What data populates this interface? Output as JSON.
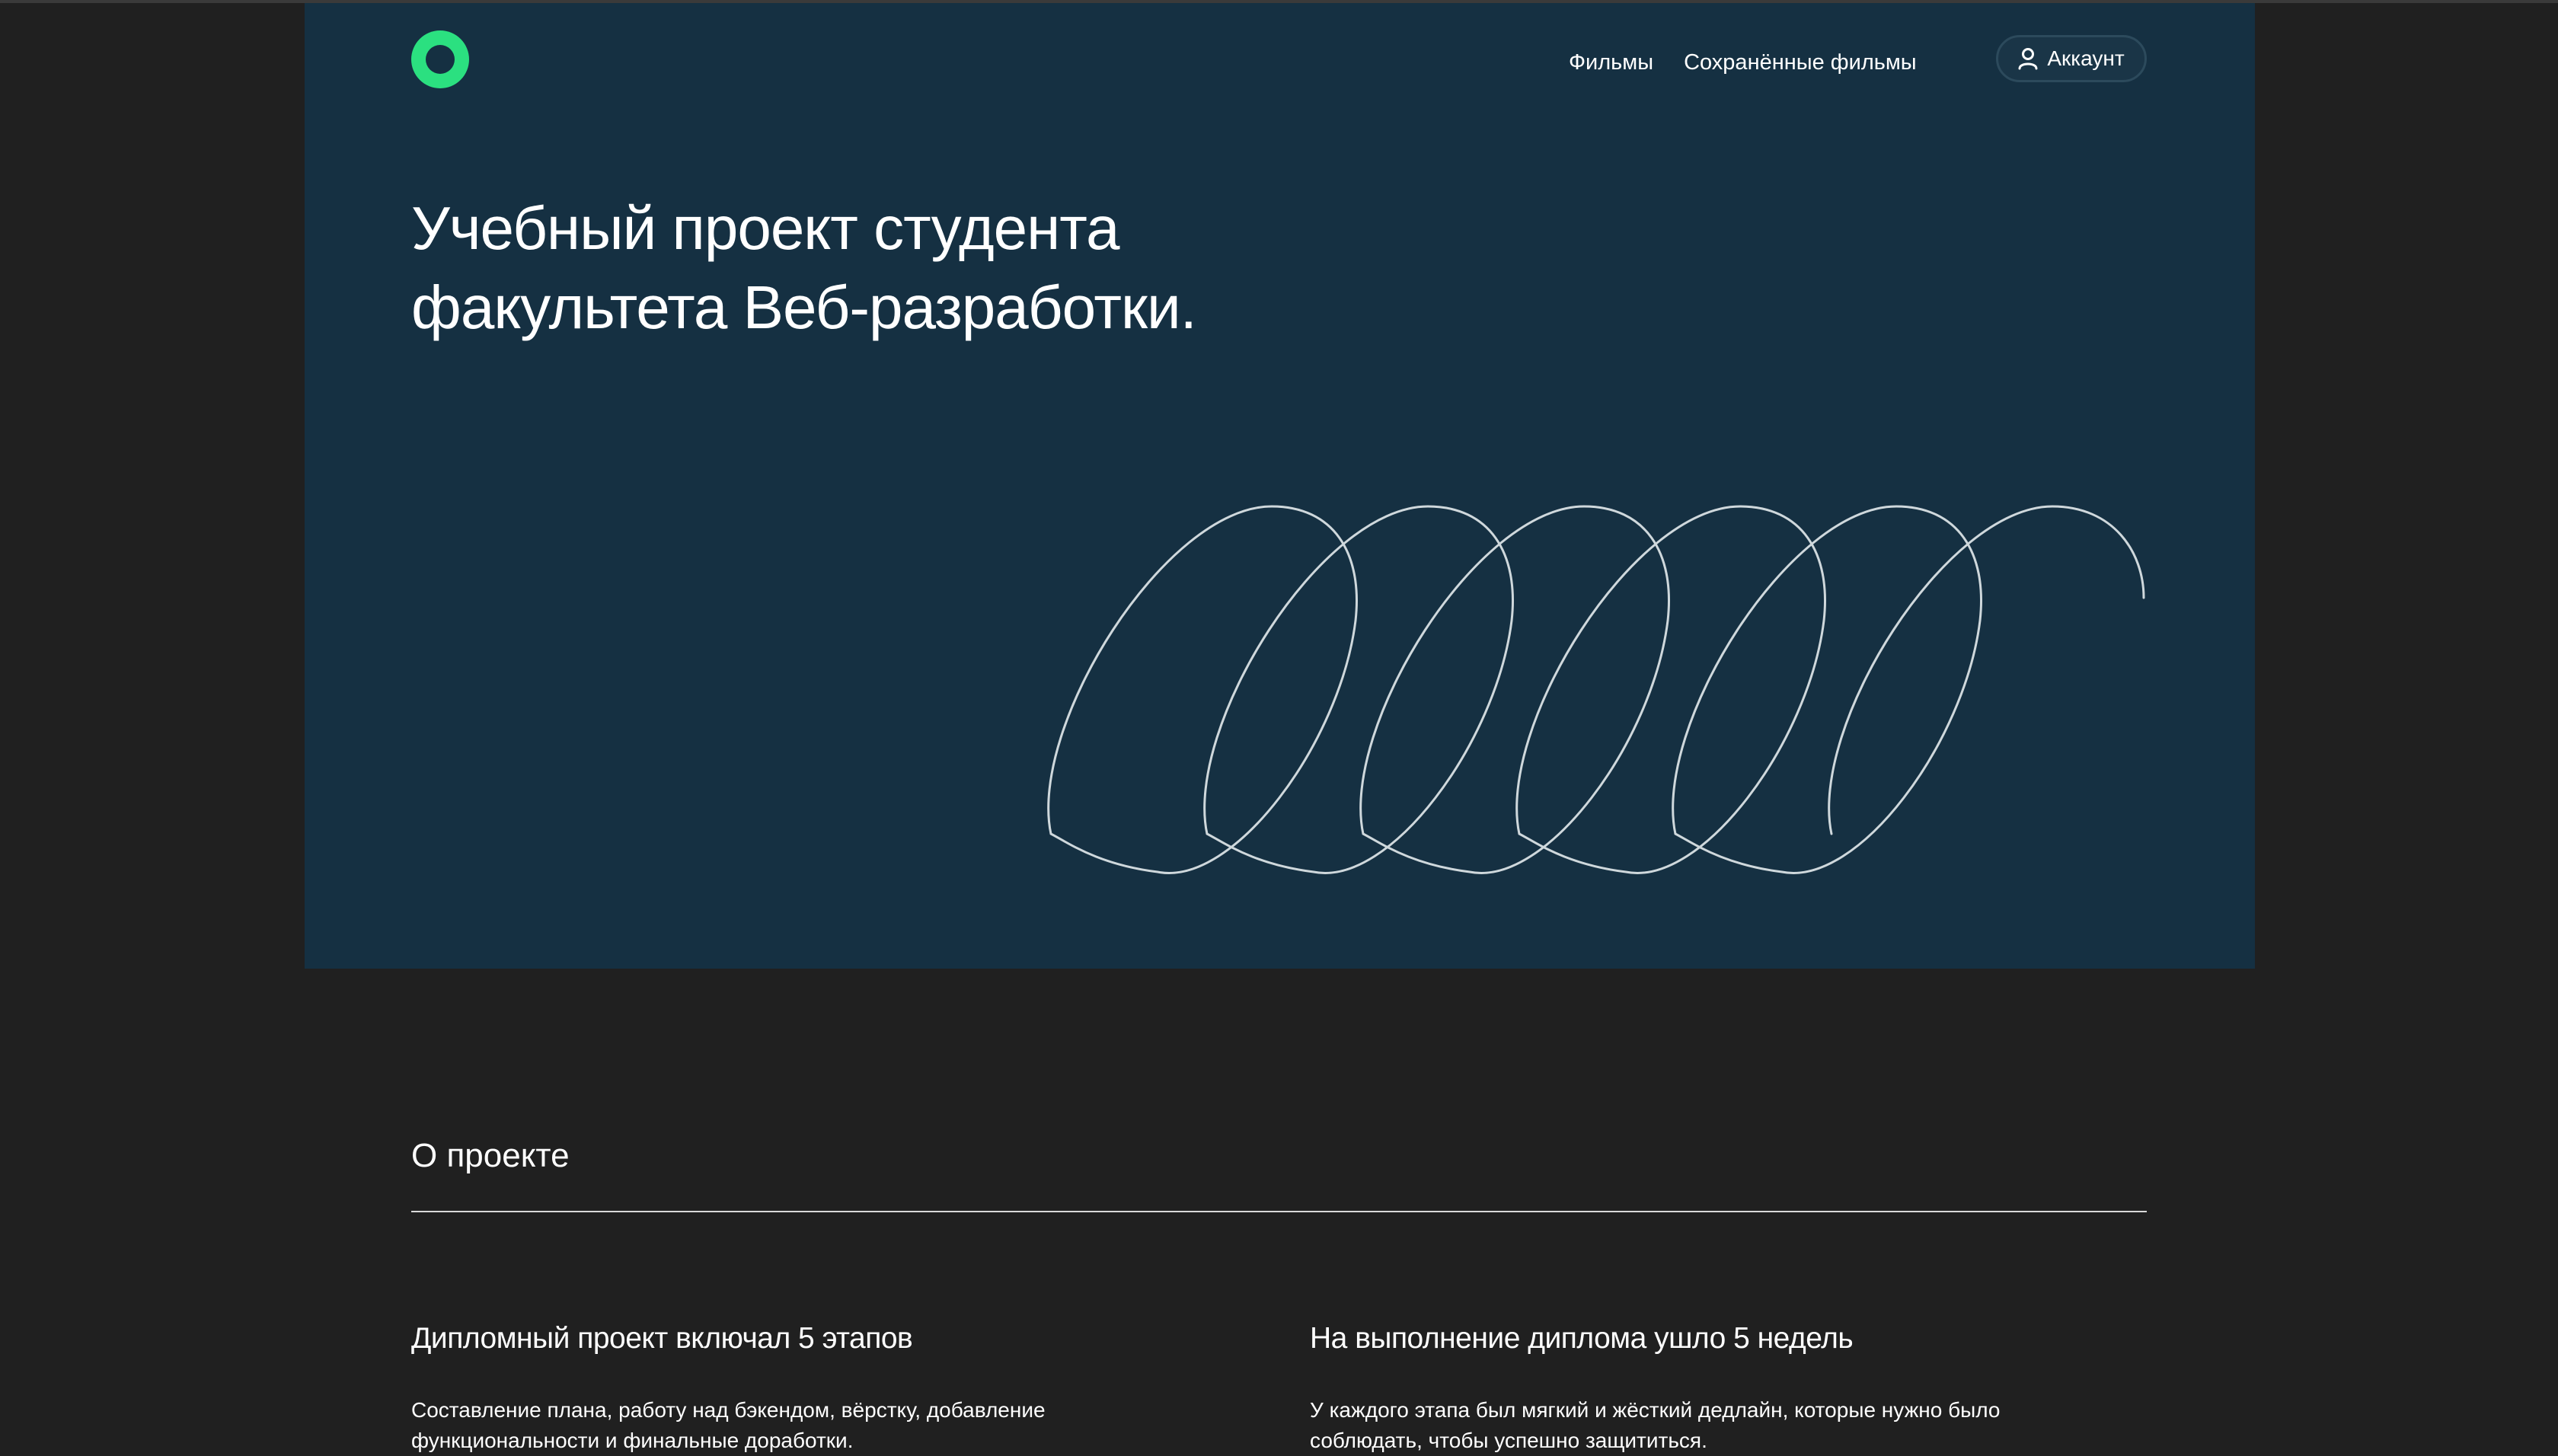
{
  "header": {
    "nav": [
      {
        "label": "Фильмы"
      },
      {
        "label": "Сохранённые фильмы"
      }
    ],
    "account_label": "Аккаунт",
    "logo_icon": "ring-logo-icon",
    "account_icon": "user-icon"
  },
  "hero": {
    "title_line1": "Учебный проект студента",
    "title_line2": "факультета Веб-разработки."
  },
  "about": {
    "title": "О проекте",
    "columns": [
      {
        "heading": "Дипломный проект включал 5 этапов",
        "text": "Составление плана, работу над бэкендом, вёрстку, добавление функциональности и финальные доработки."
      },
      {
        "heading": "На выполнение диплома ушло 5 недель",
        "text": "У каждого этапа был мягкий и жёсткий дедлайн, которые нужно было соблюдать, чтобы успешно защититься."
      }
    ]
  },
  "colors": {
    "page_background": "#202020",
    "hero_background": "#153042",
    "accent": "#2be080",
    "text": "#ffffff"
  }
}
